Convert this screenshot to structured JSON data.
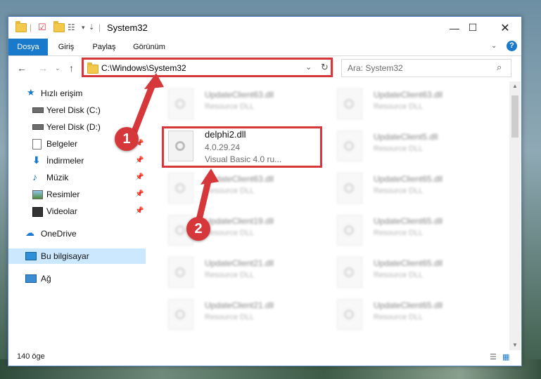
{
  "window": {
    "title": "System32"
  },
  "ribbon": {
    "tabs": [
      "Dosya",
      "Giriş",
      "Paylaş",
      "Görünüm"
    ]
  },
  "address": {
    "path": "C:\\Windows\\System32"
  },
  "search": {
    "placeholder": "Ara: System32"
  },
  "sidebar": {
    "items": [
      {
        "label": "Hızlı erişim"
      },
      {
        "label": "Yerel Disk (C:)"
      },
      {
        "label": "Yerel Disk (D:)"
      },
      {
        "label": "Belgeler"
      },
      {
        "label": "İndirmeler"
      },
      {
        "label": "Müzik"
      },
      {
        "label": "Resimler"
      },
      {
        "label": "Videolar"
      },
      {
        "label": "OneDrive"
      },
      {
        "label": "Bu bilgisayar"
      },
      {
        "label": "Ağ"
      }
    ]
  },
  "files": {
    "focused": {
      "name": "delphi2.dll",
      "version": "4.0.29.24",
      "description": "Visual Basic 4.0 ru..."
    },
    "tiles": [
      {
        "name": "UpdateClient63.dll",
        "type": "Resource DLL"
      },
      {
        "name": "UpdateClient63.dll",
        "type": "Resource DLL"
      },
      {
        "name": "UpdateClient5.dll",
        "type": "Resource DLL"
      },
      {
        "name": "UpdateClient63.dll",
        "type": "Resource DLL"
      },
      {
        "name": "UpdateClient65.dll",
        "type": "Resource DLL"
      },
      {
        "name": "UpdateClient19.dll",
        "type": "Resource DLL"
      },
      {
        "name": "UpdateClient65.dll",
        "type": "Resource DLL"
      },
      {
        "name": "UpdateClient21.dll",
        "type": "Resource DLL"
      },
      {
        "name": "UpdateClient65.dll",
        "type": "Resource DLL"
      },
      {
        "name": "UpdateClient21.dll",
        "type": "Resource DLL"
      },
      {
        "name": "UpdateClient65.dll",
        "type": "Resource DLL"
      }
    ]
  },
  "status": {
    "item_count": "140 öge"
  },
  "markers": {
    "one": "1",
    "two": "2"
  },
  "colors": {
    "accent": "#1979ca",
    "highlight": "#d6373a"
  }
}
